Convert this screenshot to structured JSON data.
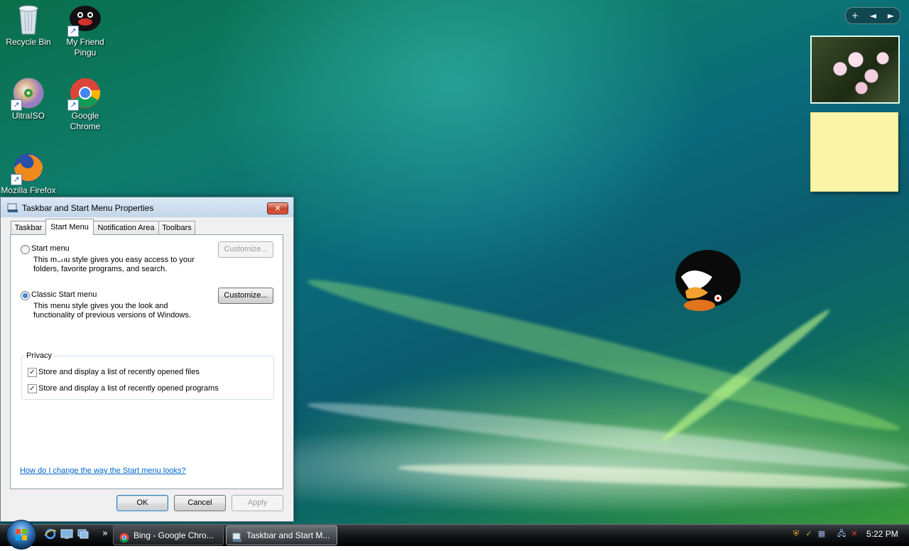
{
  "desktop": {
    "icons": [
      {
        "label": "Recycle Bin",
        "icon": "recycle-bin-icon"
      },
      {
        "label": "My Friend Pingu",
        "icon": "pingu-icon"
      },
      {
        "label": "UltraISO",
        "icon": "ultraiso-icon"
      },
      {
        "label": "Google Chrome",
        "icon": "chrome-icon"
      },
      {
        "label": "Mozilla Firefox",
        "icon": "firefox-icon"
      }
    ],
    "gadget_controls": {
      "add": "+",
      "prev": "◄",
      "next": "►"
    }
  },
  "dialog": {
    "title": "Taskbar and Start Menu Properties",
    "close_label": "✕",
    "tabs": [
      {
        "label": "Taskbar",
        "active": false
      },
      {
        "label": "Start Menu",
        "active": true
      },
      {
        "label": "Notification Area",
        "active": false
      },
      {
        "label": "Toolbars",
        "active": false
      }
    ],
    "start_menu": {
      "label": "Start menu",
      "description_line1": "This menu style gives you easy access to your",
      "description_line2": "folders, favorite programs, and search.",
      "customize_label": "Customize...",
      "selected": false
    },
    "classic_start_menu": {
      "label": "Classic Start menu",
      "description_line1": "This menu style gives you the look and",
      "description_line2": "functionality of previous versions of Windows.",
      "customize_label": "Customize...",
      "selected": true
    },
    "privacy": {
      "legend": "Privacy",
      "options": [
        {
          "label": "Store and display a list of recently opened files",
          "checked": true
        },
        {
          "label": "Store and display a list of recently opened programs",
          "checked": true
        }
      ]
    },
    "help_link": "How do I change the way the Start menu looks?",
    "buttons": {
      "ok": "OK",
      "cancel": "Cancel",
      "apply": "Apply"
    }
  },
  "taskbar": {
    "quick_launch_more": "»",
    "tasks": [
      {
        "label": "Bing - Google Chro...",
        "icon": "chrome-icon",
        "active": false
      },
      {
        "label": "Taskbar and Start M...",
        "icon": "taskbar-properties-icon",
        "active": true
      }
    ],
    "clock": "5:22 PM"
  },
  "colors": {
    "accent": "#1b5ea8",
    "link": "#0066cc",
    "sticky_note": "#fbf3a6"
  }
}
